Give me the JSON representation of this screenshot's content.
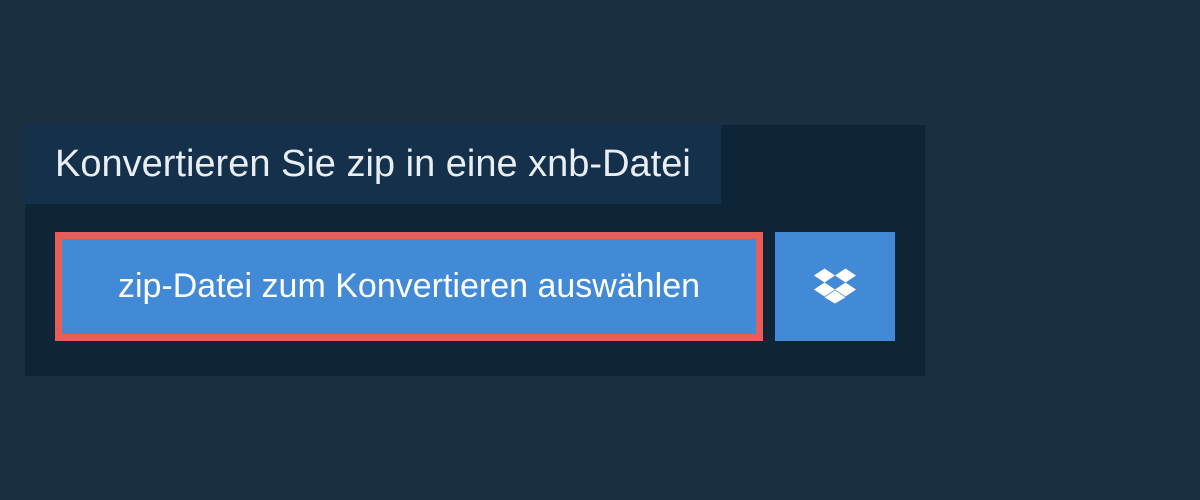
{
  "header": {
    "title": "Konvertieren Sie zip in eine xnb-Datei"
  },
  "actions": {
    "select_file_label": "zip-Datei zum Konvertieren auswählen"
  },
  "colors": {
    "bg": "#1a2f42",
    "panel": "#0e2538",
    "title_bg": "#14304a",
    "button_bg": "#4289d6",
    "highlight_border": "#e85d58",
    "text_light": "#ffffff"
  }
}
